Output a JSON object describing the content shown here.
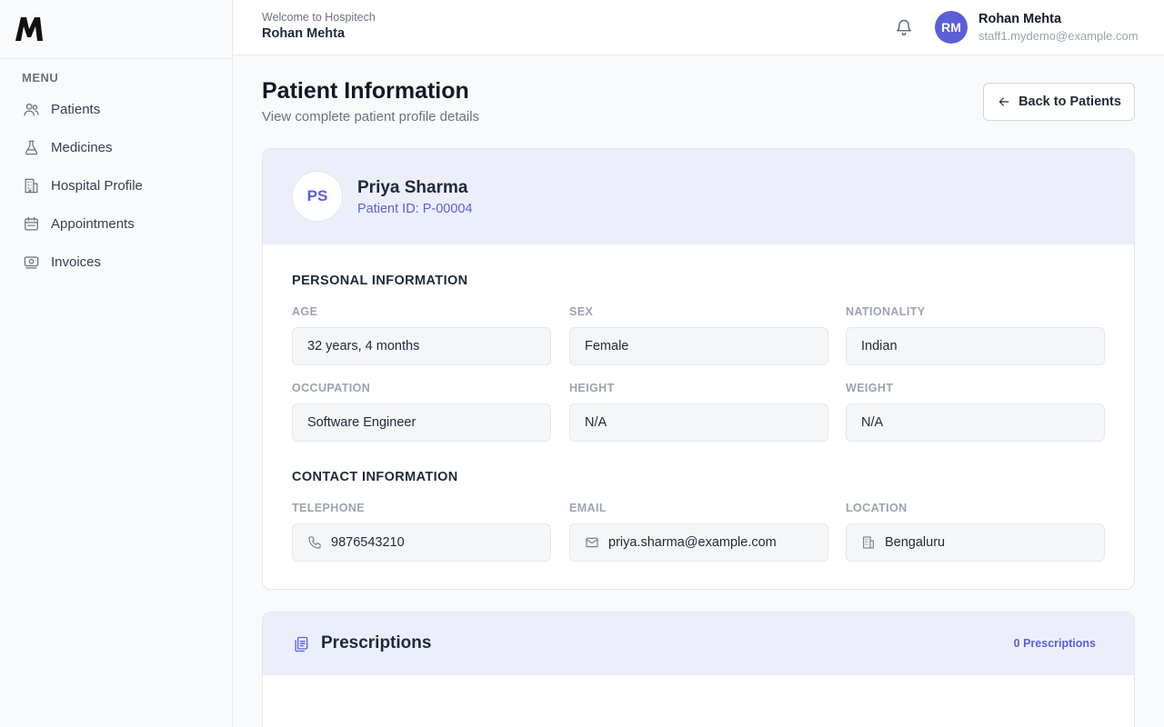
{
  "sidebar": {
    "menu_label": "MENU",
    "items": [
      {
        "label": "Patients",
        "icon": "users-icon"
      },
      {
        "label": "Medicines",
        "icon": "flask-icon"
      },
      {
        "label": "Hospital Profile",
        "icon": "building-icon"
      },
      {
        "label": "Appointments",
        "icon": "calendar-icon"
      },
      {
        "label": "Invoices",
        "icon": "banknote-icon"
      }
    ]
  },
  "header": {
    "welcome": "Welcome to Hospitech",
    "name": "Rohan Mehta",
    "user": {
      "initials": "RM",
      "name": "Rohan Mehta",
      "email": "staff1.mydemo@example.com"
    }
  },
  "page": {
    "title": "Patient Information",
    "subtitle": "View complete patient profile details",
    "back_label": "Back to Patients"
  },
  "patient": {
    "initials": "PS",
    "name": "Priya Sharma",
    "id_text": "Patient ID: P-00004"
  },
  "personal": {
    "title": "PERSONAL INFORMATION",
    "age_label": "AGE",
    "age": "32 years, 4 months",
    "sex_label": "SEX",
    "sex": "Female",
    "nationality_label": "NATIONALITY",
    "nationality": "Indian",
    "occupation_label": "OCCUPATION",
    "occupation": "Software Engineer",
    "height_label": "HEIGHT",
    "height": "N/A",
    "weight_label": "WEIGHT",
    "weight": "N/A"
  },
  "contact": {
    "title": "CONTACT INFORMATION",
    "telephone_label": "TELEPHONE",
    "telephone": "9876543210",
    "email_label": "EMAIL",
    "email": "priya.sharma@example.com",
    "location_label": "LOCATION",
    "location": "Bengaluru"
  },
  "prescriptions": {
    "title": "Prescriptions",
    "count_text": "0 Prescriptions"
  },
  "colors": {
    "accent": "#5b5fd6",
    "header_tint": "#eceffb"
  }
}
